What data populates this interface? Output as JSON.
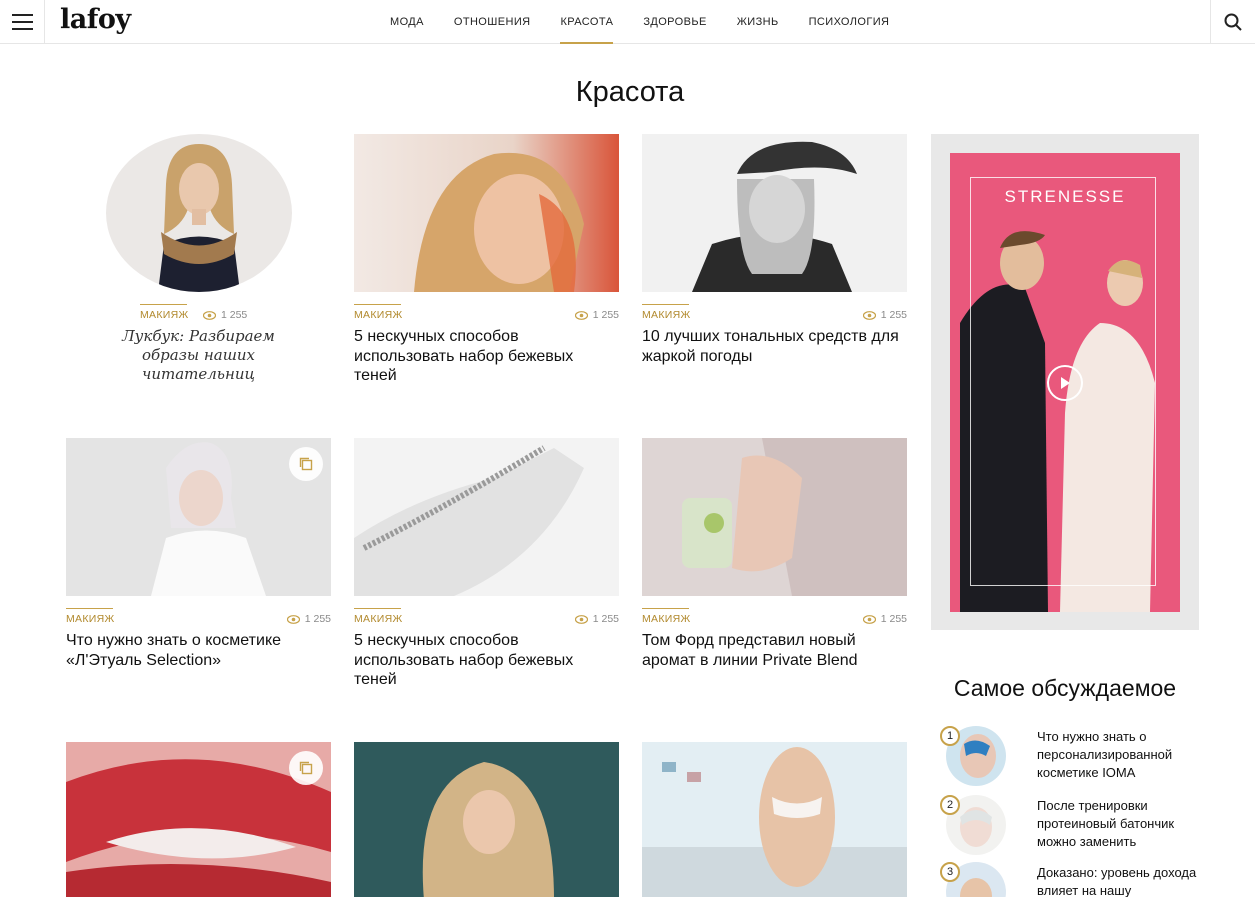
{
  "site": {
    "logo": "lafoy"
  },
  "nav": [
    {
      "label": "МОДА",
      "active": false
    },
    {
      "label": "ОТНОШЕНИЯ",
      "active": false
    },
    {
      "label": "КРАСОТА",
      "active": true
    },
    {
      "label": "ЗДОРОВЬЕ",
      "active": false
    },
    {
      "label": "ЖИЗНЬ",
      "active": false
    },
    {
      "label": "ПСИХОЛОГИЯ",
      "active": false
    }
  ],
  "page": {
    "title": "Красота"
  },
  "articles": [
    {
      "category": "МАКИЯЖ",
      "views": "1 255",
      "title": "Лукбук: Разбираем образы наших читательниц"
    },
    {
      "category": "МАКИЯЖ",
      "views": "1 255",
      "title": "5 нескучных способов использовать набор бежевых теней"
    },
    {
      "category": "МАКИЯЖ",
      "views": "1 255",
      "title": "10 лучших тональных средств для жаркой погоды"
    },
    {
      "category": "МАКИЯЖ",
      "views": "1 255",
      "title": "Что нужно знать о косметике «Л'Этуаль Selection»"
    },
    {
      "category": "МАКИЯЖ",
      "views": "1 255",
      "title": "5 нескучных способов использовать набор бежевых теней"
    },
    {
      "category": "МАКИЯЖ",
      "views": "1 255",
      "title": "Том Форд представил новый аромат в линии Private Blend"
    }
  ],
  "ad": {
    "brand": "STRENESSE"
  },
  "popular": {
    "title": "Самое обсуждаемое",
    "items": [
      {
        "num": "1",
        "text": "Что нужно знать о персонализированной косметике IOMA"
      },
      {
        "num": "2",
        "text": "После тренировки протеиновый батончик можно заменить"
      },
      {
        "num": "3",
        "text": "Доказано: уровень дохода влияет на нашу"
      }
    ]
  },
  "colors": {
    "accent": "#c7a24a",
    "ad_background": "#e9587c"
  }
}
